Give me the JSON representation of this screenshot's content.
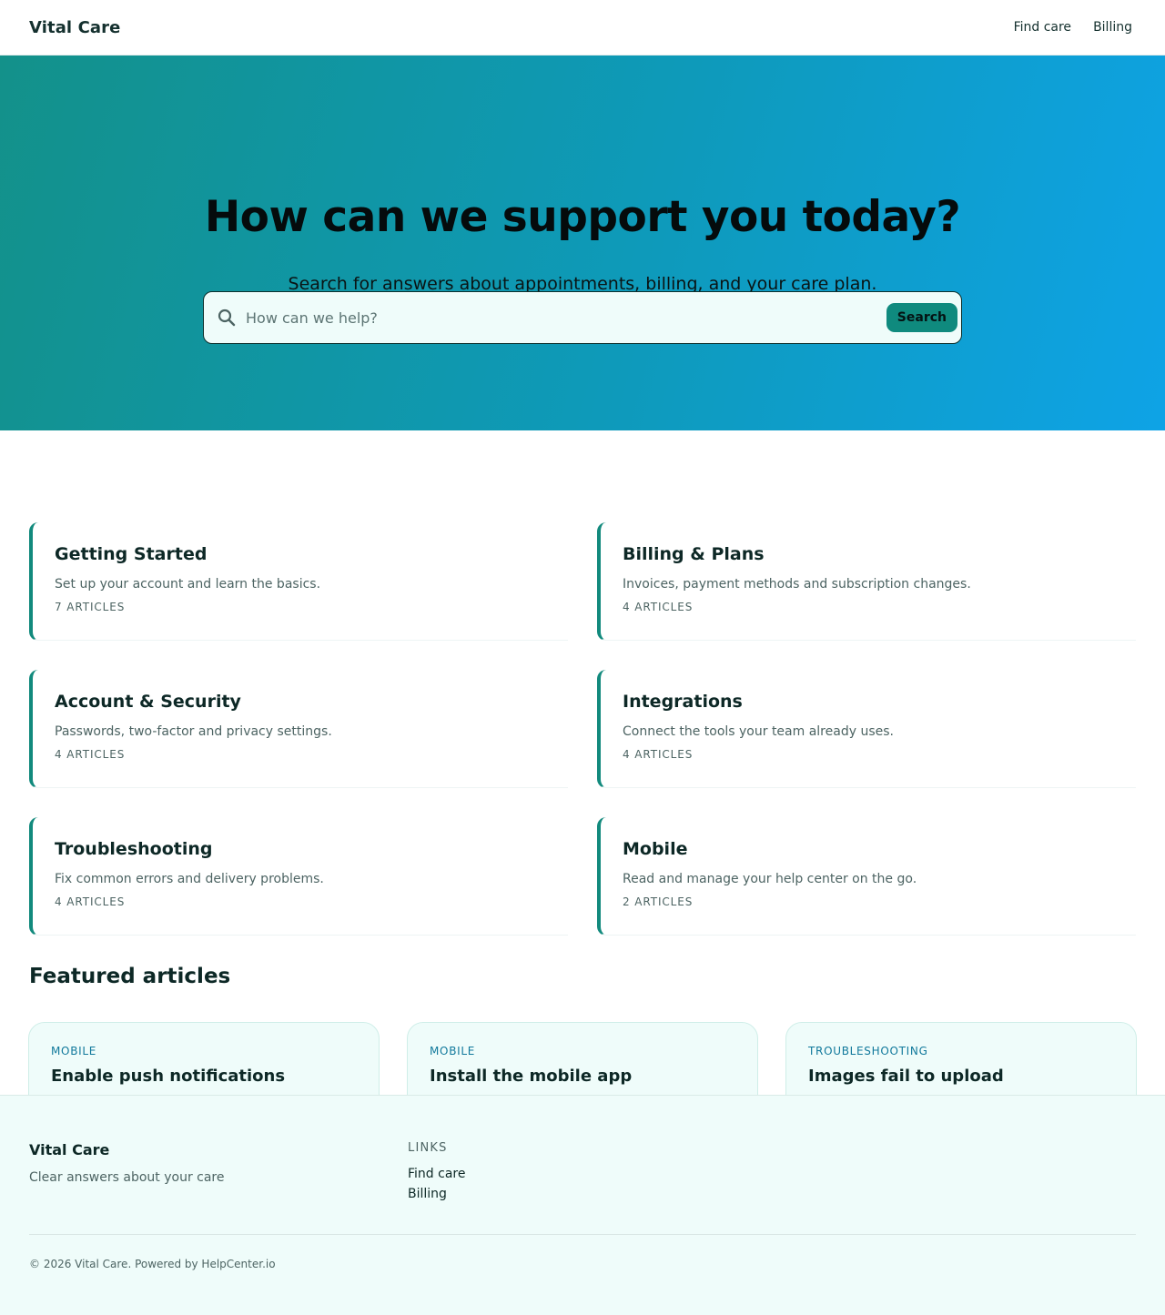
{
  "header": {
    "brand": "Vital Care",
    "nav": [
      {
        "label": "Find care"
      },
      {
        "label": "Billing"
      }
    ]
  },
  "hero": {
    "title": "How can we support you today?",
    "subtitle": "Search for answers about appointments, billing, and your care plan.",
    "search": {
      "placeholder": "How can we help?",
      "value": "",
      "button_label": "Search",
      "icon": "search-icon"
    }
  },
  "categories": [
    {
      "title": "Getting Started",
      "description": "Set up your account and learn the basics.",
      "count": "7 ARTICLES"
    },
    {
      "title": "Billing & Plans",
      "description": "Invoices, payment methods and subscription changes.",
      "count": "4 ARTICLES"
    },
    {
      "title": "Account & Security",
      "description": "Passwords, two-factor and privacy settings.",
      "count": "4 ARTICLES"
    },
    {
      "title": "Integrations",
      "description": "Connect the tools your team already uses.",
      "count": "4 ARTICLES"
    },
    {
      "title": "Troubleshooting",
      "description": "Fix common errors and delivery problems.",
      "count": "4 ARTICLES"
    },
    {
      "title": "Mobile",
      "description": "Read and manage your help center on the go.",
      "count": "2 ARTICLES"
    }
  ],
  "featured": {
    "title": "Featured articles",
    "items": [
      {
        "tag": "MOBILE",
        "title": "Enable push notifications"
      },
      {
        "tag": "MOBILE",
        "title": "Install the mobile app"
      },
      {
        "tag": "TROUBLESHOOTING",
        "title": "Images fail to upload"
      }
    ]
  },
  "footer": {
    "brand": "Vital Care",
    "tagline": "Clear answers about your care",
    "links_title": "LINKS",
    "links": [
      {
        "label": "Find care"
      },
      {
        "label": "Billing"
      }
    ],
    "copyright": "© 2026 Vital Care. Powered by HelpCenter.io"
  },
  "colors": {
    "accent": "#128a7d",
    "hero_gradient_start": "#13918a",
    "hero_gradient_end": "#0ea3e6",
    "tag_blue": "#11799c",
    "soft_background": "#effcfa"
  }
}
